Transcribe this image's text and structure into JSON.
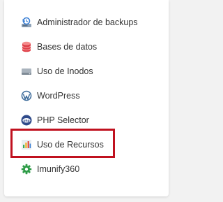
{
  "menu": {
    "items": [
      {
        "label": "Administrador de backups",
        "icon": "backup-manager-icon"
      },
      {
        "label": "Bases de datos",
        "icon": "database-icon"
      },
      {
        "label": "Uso de Inodos",
        "icon": "hard-drive-icon"
      },
      {
        "label": "WordPress",
        "icon": "wordpress-icon"
      },
      {
        "label": "PHP Selector",
        "icon": "php-icon"
      },
      {
        "label": "Uso de Recursos",
        "icon": "bar-chart-icon"
      },
      {
        "label": "Imunify360",
        "icon": "gear-icon"
      }
    ]
  },
  "highlight": {
    "target": "Uso de Recursos",
    "color": "#c0111f"
  },
  "colors": {
    "text": "#333333",
    "highlight_border": "#c0111f",
    "panel_bg": "#ffffff",
    "page_bg": "#f2f2f2"
  }
}
